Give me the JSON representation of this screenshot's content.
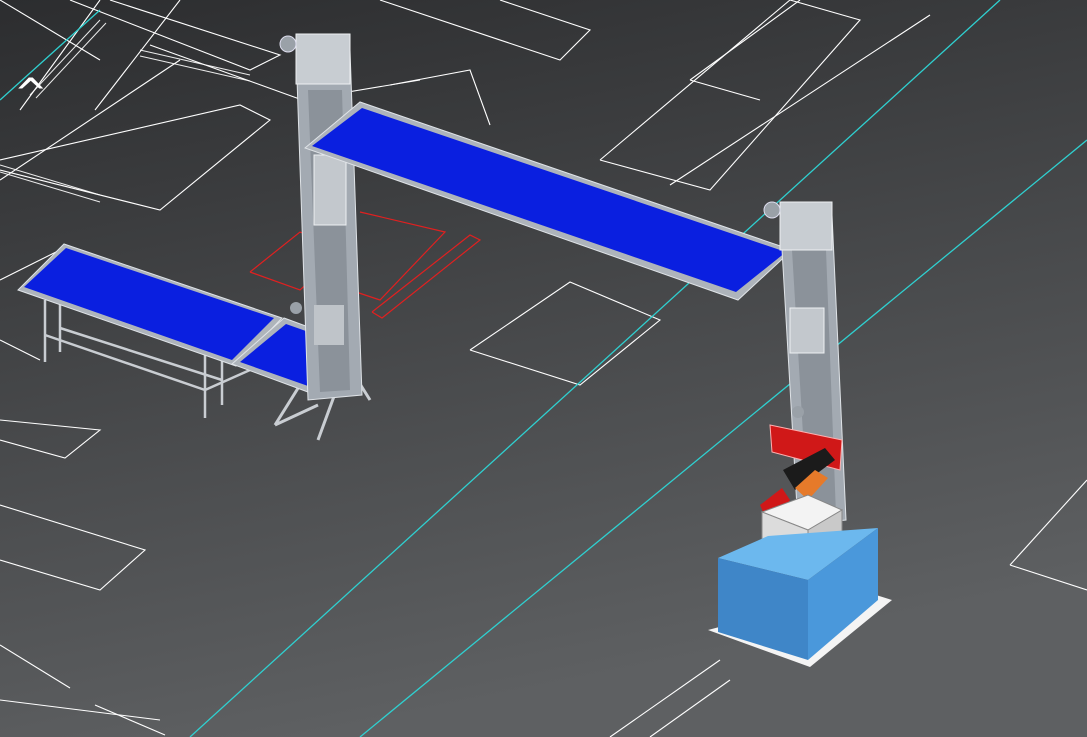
{
  "viewport": {
    "corner_glyph": "^",
    "colors": {
      "background_top": "#2e2f31",
      "background_bottom": "#606264",
      "floor_lines": "#ffffff",
      "cyan_lines": "#2fd0d0",
      "marker_lines": "#e02020",
      "conveyor_belt": "#0a1fe0",
      "frame_steel": "#b8c0c8",
      "pallet_box": "#3f86c8",
      "carton": "#eeeeee",
      "gripper_red": "#d01818"
    },
    "objects": [
      {
        "name": "left-conveyor",
        "kind": "belt-conveyor"
      },
      {
        "name": "short-conveyor",
        "kind": "belt-conveyor"
      },
      {
        "name": "left-lift-tower",
        "kind": "vertical-lift"
      },
      {
        "name": "overhead-conveyor",
        "kind": "belt-conveyor"
      },
      {
        "name": "right-lift-tower",
        "kind": "vertical-lift"
      },
      {
        "name": "gripper-head",
        "kind": "end-effector"
      },
      {
        "name": "carton-box",
        "kind": "product"
      },
      {
        "name": "pallet-stand",
        "kind": "pallet"
      }
    ]
  }
}
